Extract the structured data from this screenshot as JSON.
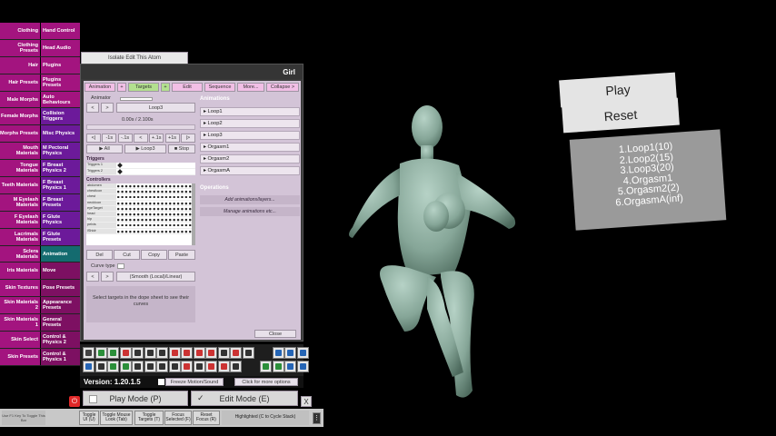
{
  "tabs": [
    [
      "Clothing",
      "Hand Control"
    ],
    [
      "Clothing Presets",
      "Head Audio"
    ],
    [
      "Hair",
      "Plugins"
    ],
    [
      "Hair Presets",
      "Plugins Presets"
    ],
    [
      "Male Morphs",
      "Auto Behaviours"
    ],
    [
      "Female Morphs",
      "Collision Triggers"
    ],
    [
      "Morphs Presets",
      "Misc Physics"
    ],
    [
      "Mouth Materials",
      "M Pectoral Physics"
    ],
    [
      "Tongue Materials",
      "F Breast Physics 2"
    ],
    [
      "Teeth Materials",
      "F Breast Physics 1"
    ],
    [
      "M Eyelash Materials",
      "F Breast Presets"
    ],
    [
      "F Eyelash Materials",
      "F Glute Physics"
    ],
    [
      "Lacrimals Materials",
      "F Glute Presets"
    ],
    [
      "Sclera Materials",
      "Animation"
    ],
    [
      "Iris Materials",
      "Move"
    ],
    [
      "Skin Textures",
      "Pose Presets"
    ],
    [
      "Skin Materials 2",
      "Appearance Presets"
    ],
    [
      "Skin Materials 1",
      "General Presets"
    ],
    [
      "Skin Select",
      "Control & Physics 2"
    ],
    [
      "Skin Presets",
      "Control & Physics 1"
    ]
  ],
  "isolate_button": "Isolate Edit This Atom",
  "panel_title": "Girl",
  "toptabs": {
    "animation": "Animation",
    "plus": "+",
    "targets": "Targets",
    "edit": "Edit",
    "sequence": "Sequence",
    "more": "More...",
    "collapse": "Collapse >"
  },
  "animator": {
    "label": "Animator",
    "prev": "<",
    "next": ">",
    "current": "Loop3",
    "time": "0.00s / 2.100s"
  },
  "step": [
    "<|",
    "-1s",
    "-.1s",
    "<",
    "+.1s",
    "+1s",
    "|>"
  ],
  "playback": {
    "all": "▶ All",
    "loop": "▶ Loop3",
    "stop": "■ Stop"
  },
  "dope": {
    "triggers_header": "Triggers",
    "triggers": [
      "Triggers 1",
      "Triggers 2"
    ],
    "controllers_header": "Controllers",
    "controllers": [
      "abdomen",
      "chestIcon",
      "chest",
      "neckIcon",
      "eyeTarget",
      "head",
      "hip",
      "pelvis",
      "lShldr"
    ]
  },
  "clip": {
    "del": "Del",
    "cut": "Cut",
    "copy": "Copy",
    "paste": "Paste"
  },
  "curve": {
    "label": "Curve type",
    "prev": "<",
    "next": ">",
    "value": "(Smooth (Local)/Linear)"
  },
  "hint": "Select targets in the dope sheet to see their curves",
  "close_button": "Close",
  "animations": {
    "header": "Animations",
    "items": [
      "▸ Loop1",
      "▸ Loop2",
      "▸ Loop3",
      "▸ Orgasm1",
      "▸ Orgasm2",
      "▸ OrgasmA"
    ]
  },
  "operations": {
    "header": "Operations",
    "add": "Add animations/layers...",
    "manage": "Manage animations etc..."
  },
  "version": "Version: 1.20.1.5",
  "freeze": "Freeze Motion/Sound",
  "more_options": "Click for more options",
  "mode": {
    "play": "Play Mode (P)",
    "edit": "Edit Mode (E)",
    "x": "X"
  },
  "bottom": {
    "hint": "Use F1 Key To Toggle This Bar",
    "toggle_ui": "Toggle UI (U)",
    "mouse_look": "Toggle Mouse Look (Tab)",
    "toggle_targets": "Toggle Targets (T)",
    "focus": "Focus Selected (F)",
    "reset_focus": "Reset Focus (R)",
    "highlighted": "Highlighted (C to Cycle Stack)"
  },
  "scene": {
    "play": "Play",
    "reset": "Reset",
    "list": [
      "1.Loop1(10)",
      "2.Loop2(15)",
      "3.Loop3(20)",
      "4.Orgasm1",
      "5.Orgasm2(2)",
      "6.OrgasmA(inf)"
    ]
  },
  "colors": {
    "magenta": "#a3147f",
    "purple": "#6c1a9a",
    "teal": "#146b6f",
    "figure": "#8fb0a4"
  }
}
